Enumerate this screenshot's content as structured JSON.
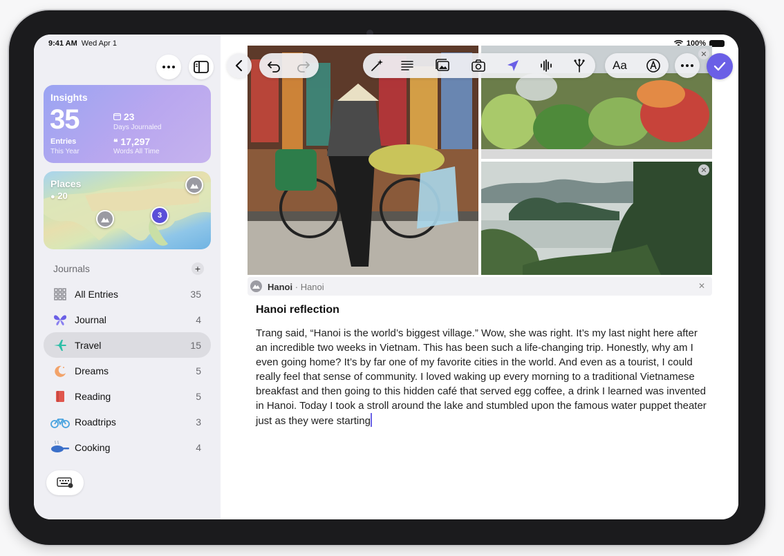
{
  "status": {
    "time": "9:41 AM",
    "date": "Wed Apr 1",
    "battery": "100%"
  },
  "insights": {
    "title": "Insights",
    "entries_value": "35",
    "entries_label": "Entries",
    "entries_sub": "This Year",
    "days_value": "23",
    "days_label": "Days Journaled",
    "words_value": "17,297",
    "words_label": "Words All Time"
  },
  "places": {
    "title": "Places",
    "count": "20",
    "cluster_count": "3"
  },
  "journals": {
    "heading": "Journals",
    "items": [
      {
        "label": "All Entries",
        "count": "35",
        "icon": "grid-icon"
      },
      {
        "label": "Journal",
        "count": "4",
        "icon": "butterfly-icon"
      },
      {
        "label": "Travel",
        "count": "15",
        "icon": "airplane-icon"
      },
      {
        "label": "Dreams",
        "count": "5",
        "icon": "moon-icon"
      },
      {
        "label": "Reading",
        "count": "5",
        "icon": "book-icon"
      },
      {
        "label": "Roadtrips",
        "count": "3",
        "icon": "bicycle-icon"
      },
      {
        "label": "Cooking",
        "count": "4",
        "icon": "pan-icon"
      }
    ]
  },
  "entry": {
    "location_name": "Hanoi",
    "location_sub": "· Hanoi",
    "title": "Hanoi reflection",
    "body": "Trang said, “Hanoi is the world’s biggest village.” Wow, she was right. It’s my last night here after an incredible two weeks in Vietnam. This has been such a life-changing trip. Honestly, why am I even going home? It’s by far one of my favorite cities in the world. And even as a tourist, I could really feel that sense of community. I loved waking up every morning to a traditional Vietnamese breakfast and then going to this hidden café that served egg coffee, a drink I learned was invented in Hanoi. Today I took a stroll around the lake and stumbled upon the famous water puppet theater just as they were starting"
  },
  "toolbar": {
    "text_format_label": "Aa"
  },
  "colors": {
    "accent": "#6a5fe6",
    "sidebar_bg": "#efeff4",
    "active_row": "#dcdce1"
  }
}
